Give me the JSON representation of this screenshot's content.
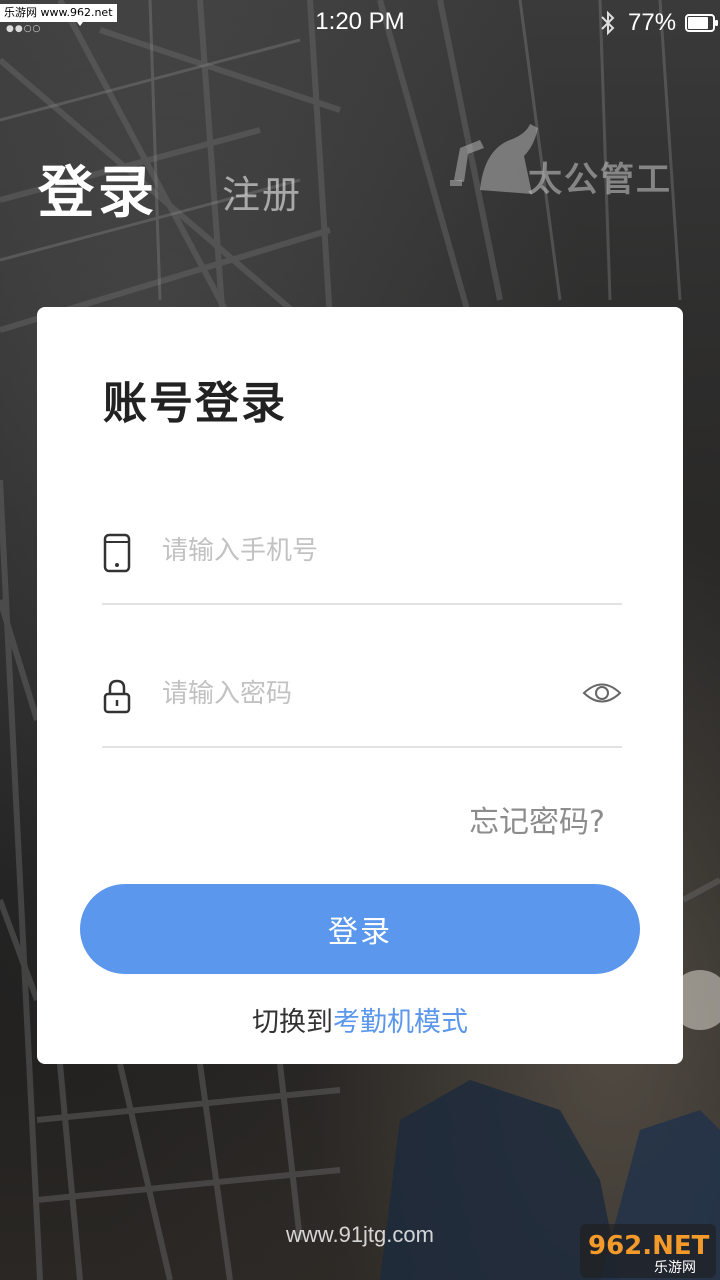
{
  "status_bar": {
    "watermark": "乐游网 www.962.net",
    "time": "1:20 PM",
    "battery": "77%"
  },
  "header": {
    "login_tab": "登录",
    "register_tab": "注册",
    "brand": "太公管工"
  },
  "card": {
    "title": "账号登录",
    "phone_placeholder": "请输入手机号",
    "password_placeholder": "请输入密码",
    "forgot": "忘记密码?",
    "login_button": "登录",
    "switch_prefix": "切换到",
    "switch_link": "考勤机模式"
  },
  "footer": {
    "url": "www.91jtg.com",
    "watermark": "962.NET",
    "watermark_sub": "乐游网"
  },
  "colors": {
    "accent": "#5b97ec",
    "card_bg": "#ffffff"
  }
}
